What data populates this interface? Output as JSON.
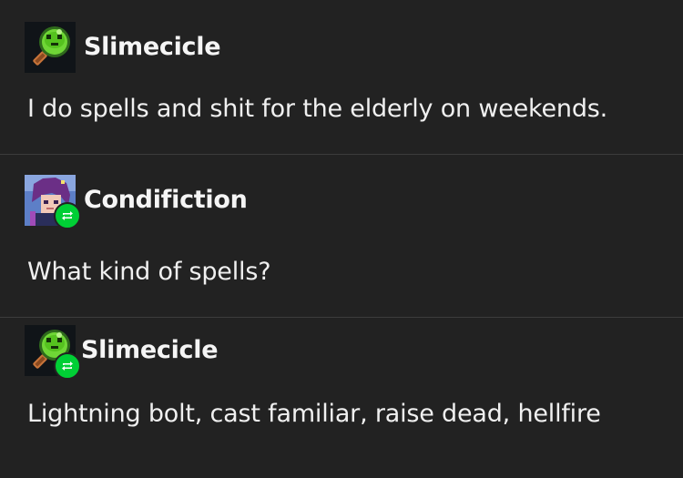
{
  "posts": [
    {
      "username": "Slimecicle",
      "avatar_icon": "slime-magnifier-icon",
      "is_reblog": false,
      "text": "I do spells and shit for the elderly on weekends."
    },
    {
      "username": "Condifiction",
      "avatar_icon": "pixel-character-avatar",
      "is_reblog": true,
      "text": "What kind of spells?"
    },
    {
      "username": "Slimecicle",
      "avatar_icon": "slime-magnifier-icon",
      "is_reblog": true,
      "text": "Lightning bolt, cast familiar, raise dead, hellfire"
    }
  ],
  "colors": {
    "background": "#222222",
    "divider": "#3c3c3c",
    "reblog_badge": "#00cf35",
    "text": "#f2f2f2"
  }
}
